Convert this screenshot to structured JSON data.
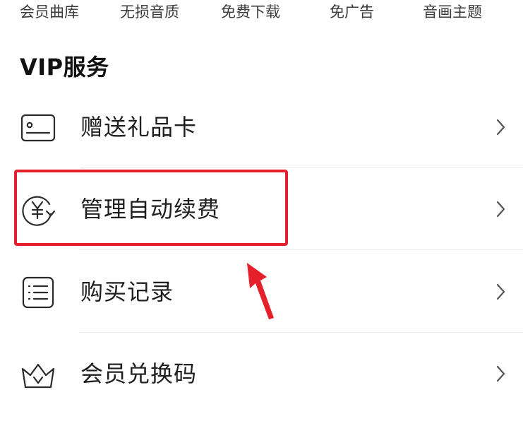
{
  "benefits": {
    "items": [
      {
        "label": "会员曲库"
      },
      {
        "label": "无损音质"
      },
      {
        "label": "免费下载"
      },
      {
        "label": "免广告"
      },
      {
        "label": "音画主题"
      }
    ]
  },
  "section": {
    "title": "VIP服务"
  },
  "menu": {
    "items": [
      {
        "label": "赠送礼品卡",
        "icon": "gift-card-icon"
      },
      {
        "label": "管理自动续费",
        "icon": "auto-renew-yuan-icon"
      },
      {
        "label": "购买记录",
        "icon": "list-icon"
      },
      {
        "label": "会员兑换码",
        "icon": "crown-icon"
      }
    ],
    "chevron_icon": "chevron-right-icon"
  },
  "annotation": {
    "highlight_color": "#e5202a",
    "highlighted_item": "管理自动续费"
  },
  "colors": {
    "text_primary": "#1f1f1f",
    "text_secondary": "#3a3a3a",
    "divider": "#ececec",
    "accent_red": "#e5202a"
  }
}
